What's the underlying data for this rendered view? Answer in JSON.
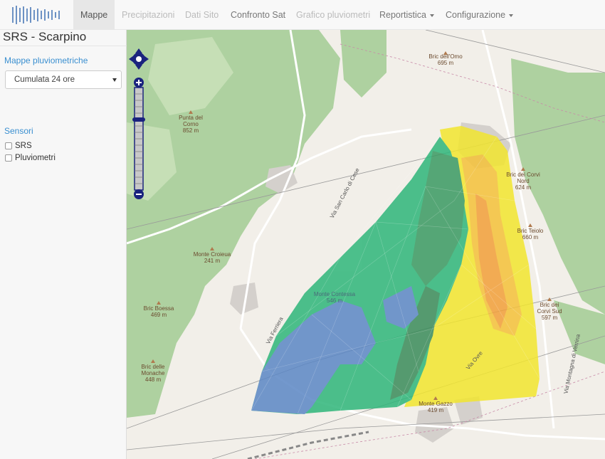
{
  "navbar": {
    "logo_icon": "rain-gauge-logo",
    "items": [
      {
        "label": "Mappe",
        "state": "active"
      },
      {
        "label": "Precipitazioni",
        "state": "disabled"
      },
      {
        "label": "Dati Sito",
        "state": "disabled"
      },
      {
        "label": "Confronto Sat",
        "state": "normal"
      },
      {
        "label": "Grafico pluviometri",
        "state": "disabled"
      },
      {
        "label": "Reportistica",
        "state": "dropdown"
      },
      {
        "label": "Configurazione",
        "state": "dropdown"
      }
    ]
  },
  "sidebar": {
    "title": "SRS - Scarpino",
    "maps_label": "Mappe pluviometriche",
    "map_select": {
      "value": "Cumulata 24 ore"
    },
    "sensors_label": "Sensori",
    "sensors": [
      {
        "label": "SRS",
        "checked": false
      },
      {
        "label": "Pluviometri",
        "checked": false
      }
    ]
  },
  "map": {
    "controls": {
      "pan_icon": "pan-arrows-icon",
      "zoom_in_icon": "zoom-in-icon",
      "zoom_out_icon": "zoom-out-icon"
    },
    "labels": [
      {
        "name": "Bric dell'Omo",
        "elevation": "695 m"
      },
      {
        "name": "Punta del Corno",
        "elevation": "852 m"
      },
      {
        "name": "Bric dei Corvi Nord",
        "elevation": "624 m"
      },
      {
        "name": "Bric Teiolo",
        "elevation": "660 m"
      },
      {
        "name": "Monte Croieua",
        "elevation": "241 m"
      },
      {
        "name": "Monte Contessa",
        "elevation": "546 m"
      },
      {
        "name": "Bric Boessa",
        "elevation": "469 m"
      },
      {
        "name": "Bric dei Corvi Sud",
        "elevation": "597 m"
      },
      {
        "name": "Bric delle Monache",
        "elevation": "448 m"
      },
      {
        "name": "Monte Gazzo",
        "elevation": "419 m"
      }
    ],
    "roads": [
      "Via San Carlo di Cese",
      "Via Ferriera",
      "Via Ovre",
      "Via Montagna di Verrina"
    ],
    "precip_colors": {
      "low": "#5b87c5",
      "mid_low": "#2fb67a",
      "mid": "#3a8c5a",
      "mid_high": "#f0e030",
      "high": "#f5a623"
    }
  }
}
